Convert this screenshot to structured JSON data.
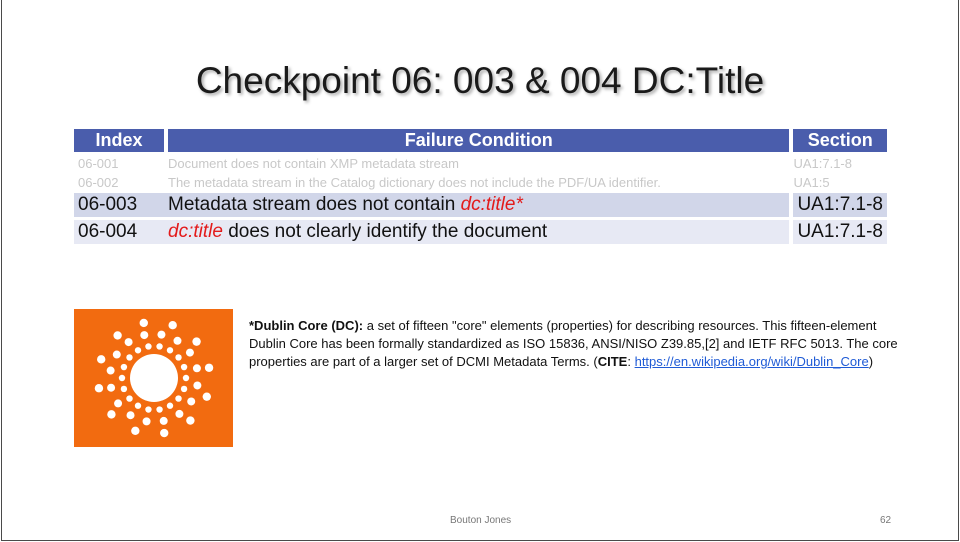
{
  "slide": {
    "title": "Checkpoint 06: 003 & 004 DC:Title",
    "table": {
      "headers": [
        "Index",
        "Failure Condition",
        "Section"
      ],
      "rows": [
        {
          "index": "06-001",
          "condition": "Document does not contain XMP metadata stream",
          "section": "UA1:7.1-8"
        },
        {
          "index": "06-002",
          "condition": "The metadata stream in the Catalog dictionary does not include the PDF/UA identifier.",
          "section": "UA1:5"
        },
        {
          "index": "06-003",
          "condition_pre": "Metadata stream does not contain ",
          "condition_em": "dc:title*",
          "section": "UA1:7.1-8"
        },
        {
          "index": "06-004",
          "condition_em": "dc:title",
          "condition_post": " does not clearly identify the document",
          "section": "UA1:7.1-8"
        }
      ]
    },
    "note": {
      "lead": "*Dublin Core (DC):",
      "body": " a set of fifteen \"core\" elements (properties) for describing resources. This fifteen-element Dublin Core has been formally standardized as ISO 15836, ANSI/NISO Z39.85,[2] and IETF RFC 5013. The core properties are part of a larger set of DCMI Metadata Terms.  (",
      "cite_label": "CITE",
      "cite_sep": ": ",
      "cite_url": "https://en.wikipedia.org/wiki/Dublin_Core",
      "close": ")"
    },
    "logo": {
      "icon": "dublin-core-logo",
      "background": "#f26b10"
    },
    "footer": {
      "author": "Bouton Jones",
      "page": "62"
    }
  }
}
